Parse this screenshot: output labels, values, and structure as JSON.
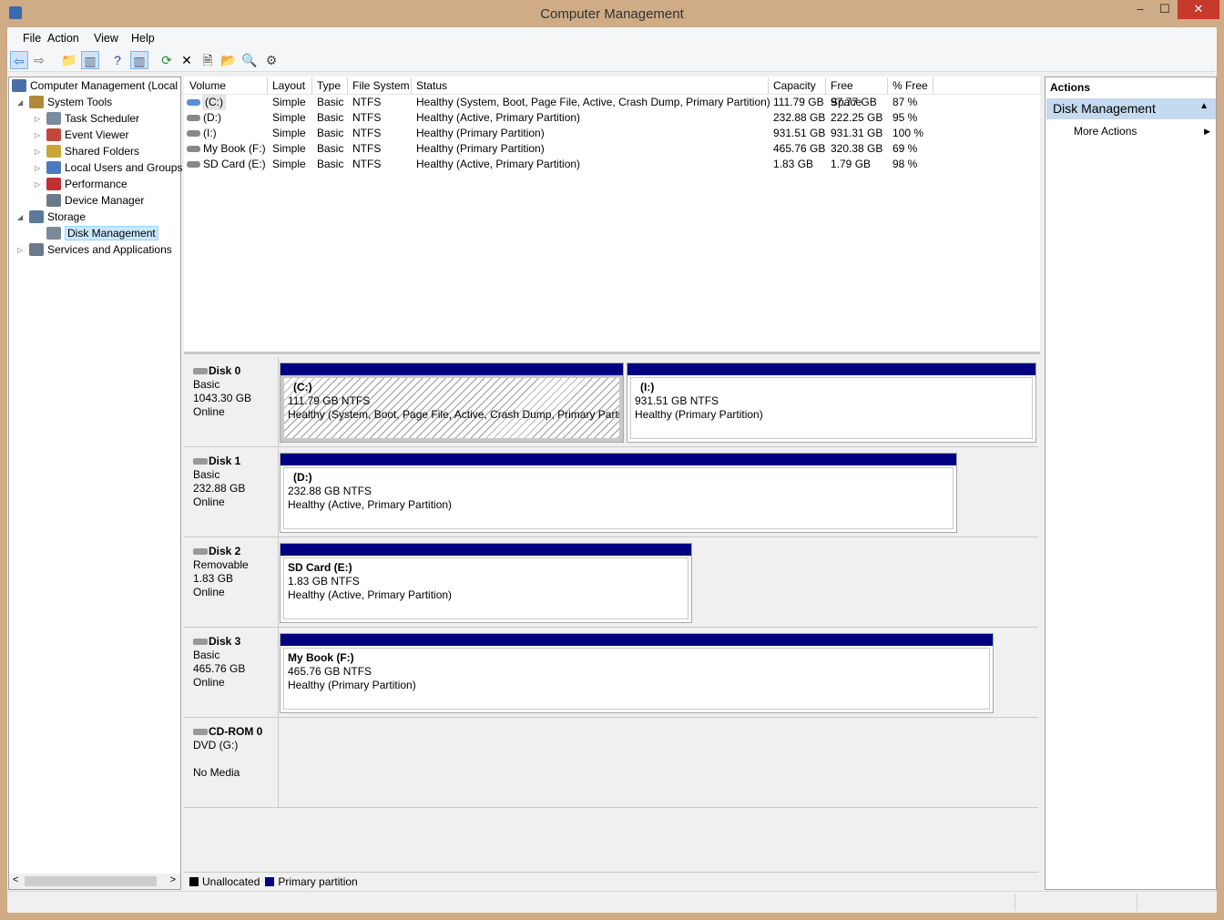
{
  "window": {
    "title": "Computer Management",
    "minimize": "–",
    "maximize": "☐",
    "close": "✕"
  },
  "menu": [
    "File",
    "Action",
    "View",
    "Help"
  ],
  "toolbar": [
    "back",
    "forward",
    "up-folder",
    "show-hide-console-tree",
    "help",
    "show-hide-action-pane",
    "refresh",
    "delete",
    "properties",
    "open",
    "search",
    "settings"
  ],
  "tree": {
    "root": "Computer Management (Local",
    "items": [
      {
        "label": "System Tools",
        "level": 1,
        "expander": "◢"
      },
      {
        "label": "Task Scheduler",
        "level": 2,
        "expander": "▷"
      },
      {
        "label": "Event Viewer",
        "level": 2,
        "expander": "▷"
      },
      {
        "label": "Shared Folders",
        "level": 2,
        "expander": "▷"
      },
      {
        "label": "Local Users and Groups",
        "level": 2,
        "expander": "▷"
      },
      {
        "label": "Performance",
        "level": 2,
        "expander": "▷"
      },
      {
        "label": "Device Manager",
        "level": 2,
        "expander": ""
      },
      {
        "label": "Storage",
        "level": 1,
        "expander": "◢"
      },
      {
        "label": "Disk Management",
        "level": 2,
        "expander": "",
        "selected": true
      },
      {
        "label": "Services and Applications",
        "level": 1,
        "expander": "▷"
      }
    ]
  },
  "volumes": {
    "columns": [
      "Volume",
      "Layout",
      "Type",
      "File System",
      "Status",
      "Capacity",
      "Free Space",
      "% Free"
    ],
    "rows": [
      [
        "(C:)",
        "Simple",
        "Basic",
        "NTFS",
        "Healthy (System, Boot, Page File, Active, Crash Dump, Primary Partition)",
        "111.79 GB",
        "97.77 GB",
        "87 %"
      ],
      [
        "(D:)",
        "Simple",
        "Basic",
        "NTFS",
        "Healthy (Active, Primary Partition)",
        "232.88 GB",
        "222.25 GB",
        "95 %"
      ],
      [
        "(I:)",
        "Simple",
        "Basic",
        "NTFS",
        "Healthy (Primary Partition)",
        "931.51 GB",
        "931.31 GB",
        "100 %"
      ],
      [
        "My Book (F:)",
        "Simple",
        "Basic",
        "NTFS",
        "Healthy (Primary Partition)",
        "465.76 GB",
        "320.38 GB",
        "69 %"
      ],
      [
        "SD Card (E:)",
        "Simple",
        "Basic",
        "NTFS",
        "Healthy (Active, Primary Partition)",
        "1.83 GB",
        "1.79 GB",
        "98 %"
      ]
    ]
  },
  "disks": [
    {
      "name": "Disk 0",
      "type": "Basic",
      "size": "1043.30 GB",
      "state": "Online",
      "partitions": [
        {
          "name": "(C:)",
          "size": "111.79 GB NTFS",
          "status": "Healthy (System, Boot, Page File, Active, Crash Dump, Primary Partition)",
          "selected": true
        },
        {
          "name": "(I:)",
          "size": "931.51 GB NTFS",
          "status": "Healthy (Primary Partition)"
        }
      ]
    },
    {
      "name": "Disk 1",
      "type": "Basic",
      "size": "232.88 GB",
      "state": "Online",
      "partitions": [
        {
          "name": "(D:)",
          "size": "232.88 GB NTFS",
          "status": "Healthy (Active, Primary Partition)"
        }
      ]
    },
    {
      "name": "Disk 2",
      "type": "Removable",
      "size": "1.83 GB",
      "state": "Online",
      "partitions": [
        {
          "name": "SD Card  (E:)",
          "size": "1.83 GB NTFS",
          "status": "Healthy (Active, Primary Partition)"
        }
      ]
    },
    {
      "name": "Disk 3",
      "type": "Basic",
      "size": "465.76 GB",
      "state": "Online",
      "partitions": [
        {
          "name": "My Book  (F:)",
          "size": "465.76 GB NTFS",
          "status": "Healthy (Primary Partition)"
        }
      ]
    },
    {
      "name": "CD-ROM 0",
      "type": "DVD (G:)",
      "size": "",
      "state": "No Media",
      "partitions": []
    }
  ],
  "legend": [
    {
      "label": "Unallocated",
      "color": "#000000"
    },
    {
      "label": "Primary partition",
      "color": "#000080"
    }
  ],
  "actions": {
    "header": "Actions",
    "section": "Disk Management",
    "items": [
      "More Actions"
    ]
  }
}
